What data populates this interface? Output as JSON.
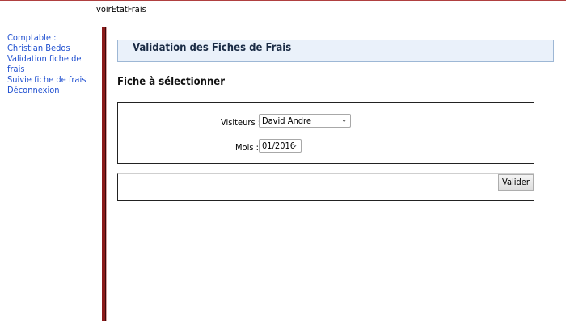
{
  "page_heading": "voirEtatFrais",
  "sidebar": {
    "user_role": "Comptable :",
    "user_name": "Christian Bedos",
    "items": [
      {
        "label": "Validation fiche de frais"
      },
      {
        "label": "Suivie fiche de frais"
      },
      {
        "label": "Déconnexion"
      }
    ]
  },
  "main": {
    "title": "Validation des Fiches de Frais",
    "section_title": "Fiche à sélectionner",
    "form": {
      "visitor_label": "Visiteurs :",
      "visitor_value": "David Andre",
      "month_label": "Mois :",
      "month_value": "01/2016"
    },
    "validate_label": "Valider"
  },
  "colors": {
    "link": "#1f4fd0",
    "divider": "#8b1a1a",
    "title_box_bg": "#eaf1fa"
  }
}
